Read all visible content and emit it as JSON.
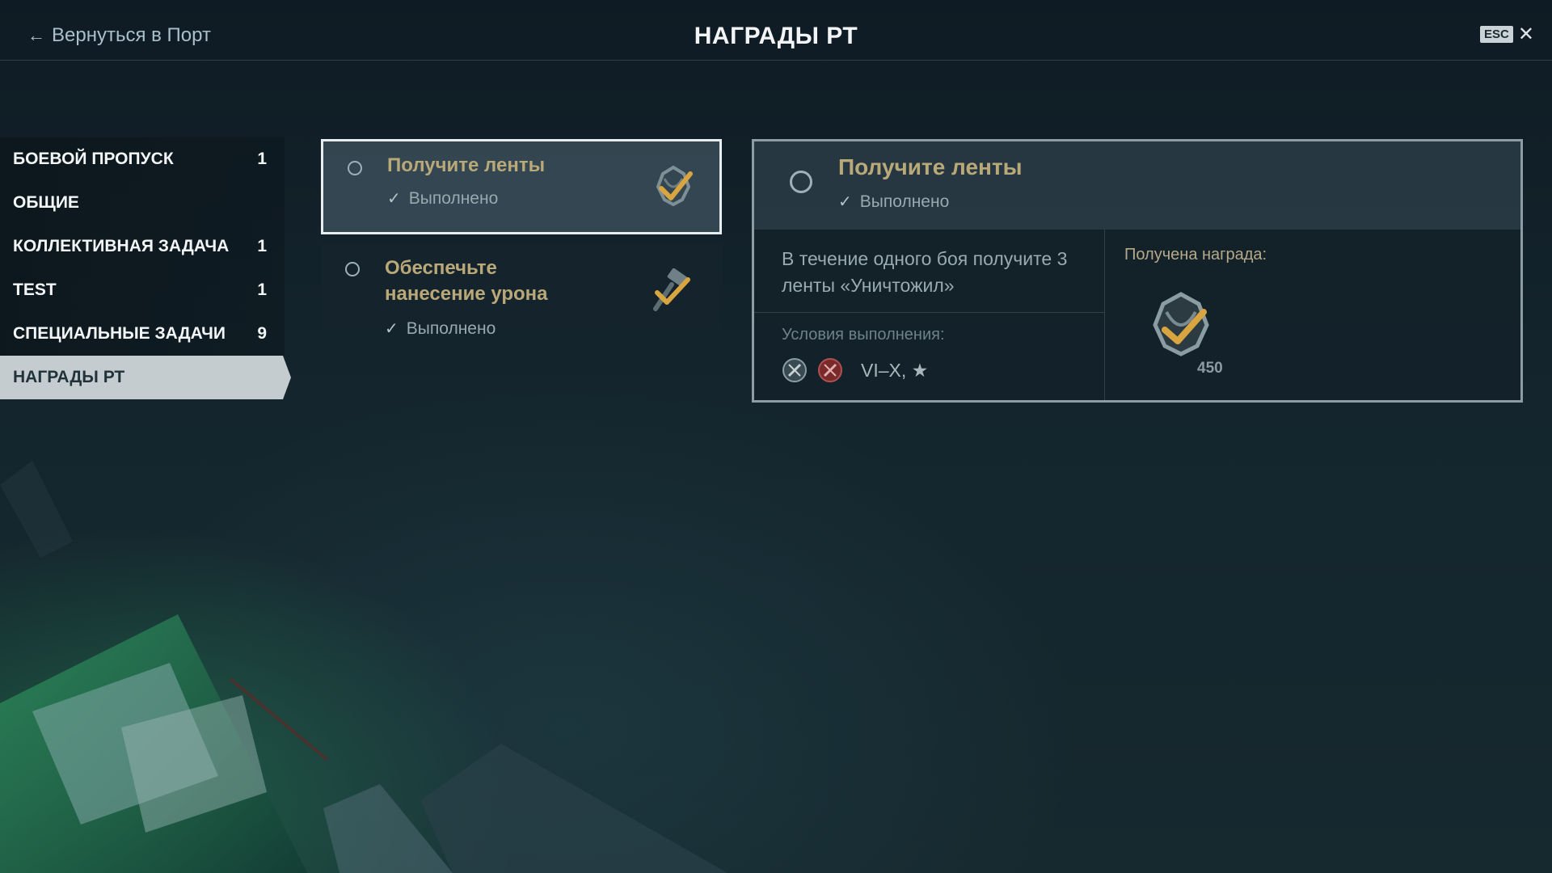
{
  "header": {
    "back_label": "Вернуться в Порт",
    "title": "НАГРАДЫ РТ",
    "esc_key": "ESC",
    "close_glyph": "✕"
  },
  "sidebar": {
    "items": [
      {
        "label": "БОЕВОЙ ПРОПУСК",
        "count": "1"
      },
      {
        "label": "ОБЩИЕ",
        "count": ""
      },
      {
        "label": "КОЛЛЕКТИВНАЯ ЗАДАЧА",
        "count": "1"
      },
      {
        "label": "TEST",
        "count": "1"
      },
      {
        "label": "СПЕЦИАЛЬНЫЕ ЗАДАЧИ",
        "count": "9"
      },
      {
        "label": "НАГРАДЫ РТ",
        "count": ""
      }
    ],
    "active_index": 5
  },
  "tasks": [
    {
      "title": "Получите ленты",
      "status": "Выполнено",
      "icon": "ribbon-check-icon",
      "selected": true
    },
    {
      "title": "Обеспечьте нанесение урона",
      "status": "Выполнено",
      "icon": "hammer-check-icon",
      "selected": false
    }
  ],
  "detail": {
    "title": "Получите ленты",
    "status": "Выполнено",
    "description": "В течение одного боя получите 3 ленты «Уничтожил»",
    "conditions_label": "Условия выполнения:",
    "conditions_icons": [
      "mode-random-icon",
      "mode-ranked-icon"
    ],
    "conditions_tiers": "VI–X, ★",
    "reward_label": "Получена награда:",
    "reward_icon": "ribbon-container-icon",
    "reward_count": "450"
  },
  "colors": {
    "accent_gold": "#b9a878",
    "active_tab": "#c4ccd0",
    "check_gold": "#d8a540"
  }
}
